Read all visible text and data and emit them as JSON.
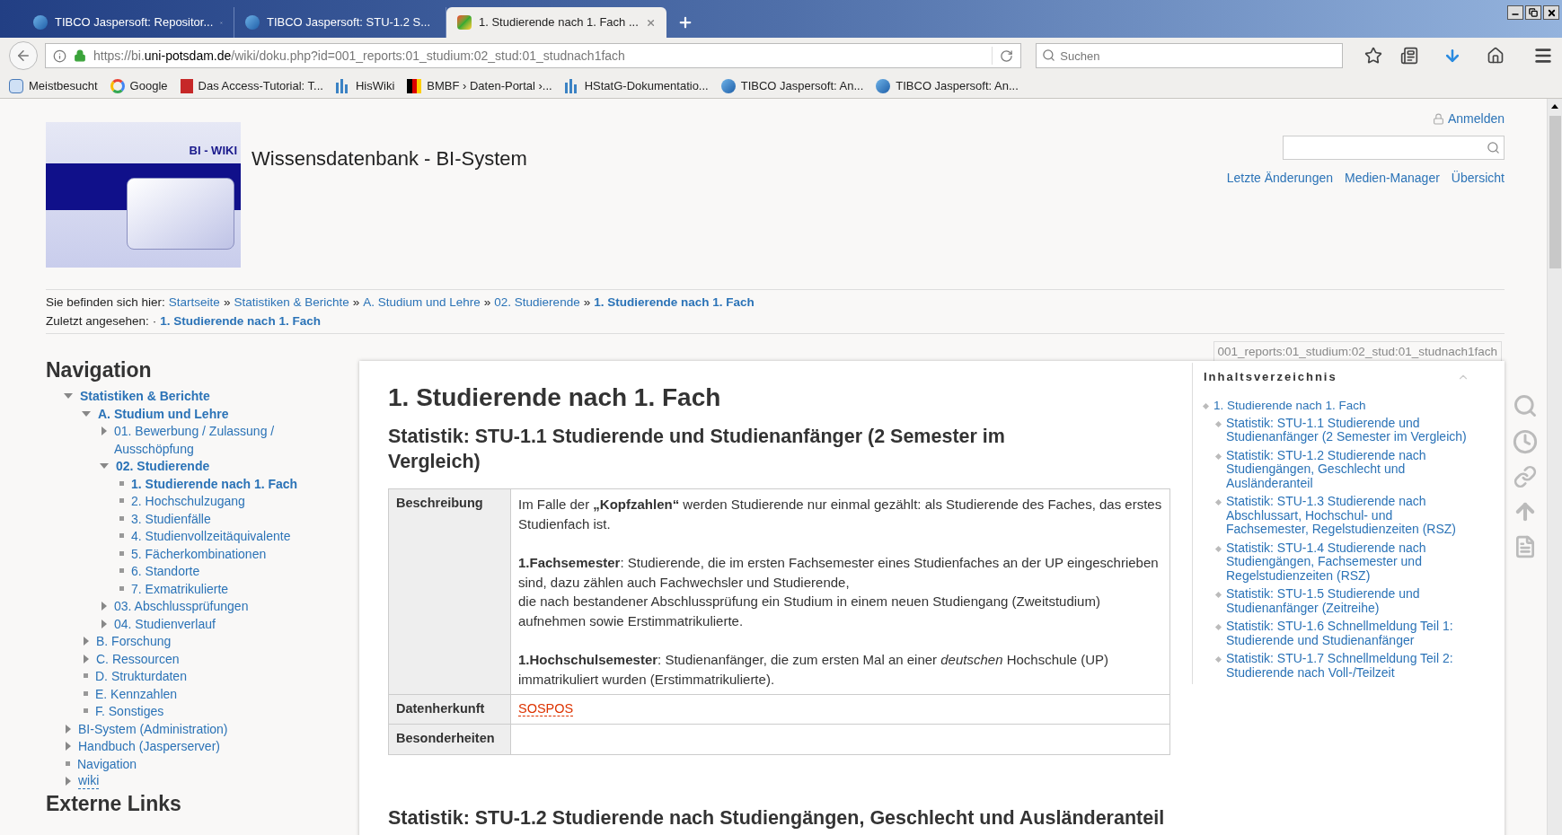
{
  "browser": {
    "tabs": [
      {
        "title": "TIBCO Jaspersoft: Repositor...",
        "selected": false
      },
      {
        "title": "TIBCO Jaspersoft: STU-1.2 S...",
        "selected": false
      },
      {
        "title": "1. Studierende nach 1. Fach ...",
        "selected": true
      }
    ],
    "url_host_prefix": "https://bi.",
    "url_host": "uni-potsdam.de",
    "url_path": "/wiki/doku.php?id=001_reports:01_studium:02_stud:01_studnach1fach",
    "search_placeholder": "Suchen",
    "bookmarks": [
      "Meistbesucht",
      "Google",
      "Das Access-Tutorial: T...",
      "HisWiki",
      "BMBF › Daten-Portal ›...",
      "HStatG-Dokumentatio...",
      "TIBCO Jaspersoft: An...",
      "TIBCO Jaspersoft: An..."
    ]
  },
  "header": {
    "logo_text": "BI - WIKI",
    "site_title": "Wissensdatenbank - BI-System",
    "login": "Anmelden",
    "links": [
      "Letzte Änderungen",
      "Medien-Manager",
      "Übersicht"
    ]
  },
  "breadcrumb": {
    "label": "Sie befinden sich hier:",
    "separator": "»",
    "items": [
      {
        "label": "Startseite",
        "current": false
      },
      {
        "label": "Statistiken & Berichte",
        "current": false
      },
      {
        "label": "A. Studium und Lehre",
        "current": false
      },
      {
        "label": "02. Studierende",
        "current": false
      },
      {
        "label": "1. Studierende nach 1. Fach",
        "current": true
      }
    ]
  },
  "last_seen": {
    "label": "Zuletzt angesehen:",
    "bullet": "·",
    "item": "1. Studierende nach 1. Fach"
  },
  "sidebar": {
    "heading": "Navigation",
    "tree": [
      {
        "label": "Statistiken & Berichte",
        "kind": "folder",
        "expanded": true,
        "children": [
          {
            "label": "A. Studium und Lehre",
            "kind": "folder",
            "expanded": true,
            "children": [
              {
                "label": "01. Bewerbung / Zulassung / Ausschöpfung",
                "kind": "folder",
                "expanded": false
              },
              {
                "label": "02. Studierende",
                "kind": "folder",
                "expanded": true,
                "children": [
                  {
                    "label": "1. Studierende nach 1. Fach",
                    "kind": "page",
                    "current": true
                  },
                  {
                    "label": "2. Hochschulzugang",
                    "kind": "page",
                    "current": false
                  },
                  {
                    "label": "3. Studienfälle",
                    "kind": "page",
                    "current": false
                  },
                  {
                    "label": "4. Studienvollzeitäquivalente",
                    "kind": "page",
                    "current": false
                  },
                  {
                    "label": "5. Fächerkombinationen",
                    "kind": "page",
                    "current": false
                  },
                  {
                    "label": "6. Standorte",
                    "kind": "page",
                    "current": false
                  },
                  {
                    "label": "7. Exmatrikulierte",
                    "kind": "page",
                    "current": false
                  }
                ]
              },
              {
                "label": "03. Abschlussprüfungen",
                "kind": "folder",
                "expanded": false
              },
              {
                "label": "04. Studienverlauf",
                "kind": "folder",
                "expanded": false
              }
            ]
          },
          {
            "label": "B. Forschung",
            "kind": "folder",
            "expanded": false
          },
          {
            "label": "C. Ressourcen",
            "kind": "folder",
            "expanded": false
          },
          {
            "label": "D. Strukturdaten",
            "kind": "page",
            "current": false
          },
          {
            "label": "E. Kennzahlen",
            "kind": "page",
            "current": false
          },
          {
            "label": "F. Sonstiges",
            "kind": "page",
            "current": false
          }
        ]
      },
      {
        "label": "BI-System (Administration)",
        "kind": "folder",
        "expanded": false
      },
      {
        "label": "Handbuch (Jasperserver)",
        "kind": "folder",
        "expanded": false
      },
      {
        "label": "Navigation",
        "kind": "page",
        "current": false
      },
      {
        "label": "wiki",
        "kind": "missing_folder",
        "expanded": false
      }
    ],
    "heading_2": "Externe Links"
  },
  "page_id": "001_reports:01_studium:02_stud:01_studnach1fach",
  "content": {
    "title": "1. Studierende nach 1. Fach",
    "section_title": "Statistik: STU-1.1 Studierende und Studienanfänger (2 Semester im Vergleich)",
    "table": [
      {
        "label": "Beschreibung",
        "kind": "text",
        "paragraphs": [
          [
            "Im Falle der **„Kopfzahlen“** werden Studierende nur einmal gezählt: als Studierende des Faches, das erstes Studienfach ist."
          ],
          [
            "**1.Fachsemester**: Studierende, die im ersten Fachsemester eines Studienfaches an der UP eingeschrieben sind, dazu zählen auch Fachwechsler und Studierende,",
            "die nach bestandener Abschlussprüfung ein Studium in einem neuen Studiengang (Zweitstudium) aufnehmen sowie Erstimmatrikulierte."
          ],
          [
            "**1.Hochschulsemester**: Studienanfänger, die zum ersten Mal an einer *deutschen* Hochschule (UP) immatrikuliert wurden (Erstimmatrikulierte)."
          ]
        ]
      },
      {
        "label": "Datenherkunft",
        "kind": "missing_link",
        "value": "SOSPOS"
      },
      {
        "label": "Besonderheiten",
        "kind": "empty"
      }
    ],
    "next_section_title": "Statistik: STU-1.2 Studierende nach Studiengängen, Geschlecht und Ausländeranteil"
  },
  "toc": {
    "heading": "Inhaltsverzeichnis",
    "items": [
      {
        "label": "1. Studierende nach 1. Fach",
        "children": [
          {
            "label": "Statistik: STU-1.1 Studierende und Studienanfänger (2 Semester im Vergleich)"
          },
          {
            "label": "Statistik: STU-1.2 Studierende nach Studiengängen, Geschlecht und Ausländeranteil"
          },
          {
            "label": "Statistik: STU-1.3 Studierende nach Abschlussart, Hochschul- und Fachsemester, Regelstudienzeiten (RSZ)"
          },
          {
            "label": "Statistik: STU-1.4 Studierende nach Studiengängen, Fachsemester und Regelstudienzeiten (RSZ)"
          },
          {
            "label": "Statistik: STU-1.5 Studierende und Studienanfänger (Zeitreihe)"
          },
          {
            "label": "Statistik: STU-1.6 Schnellmeldung Teil 1: Studierende und Studienanfänger"
          },
          {
            "label": "Statistik: STU-1.7 Schnellmeldung Teil 2: Studierende nach Voll-/Teilzeit"
          }
        ]
      }
    ]
  }
}
